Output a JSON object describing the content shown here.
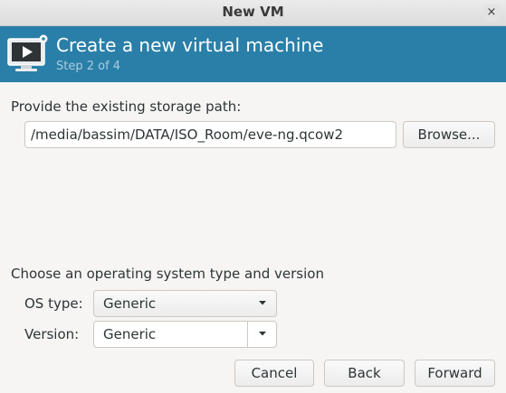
{
  "window": {
    "title": "New VM",
    "close_glyph": "×"
  },
  "banner": {
    "heading": "Create a new virtual machine",
    "step": "Step 2 of 4",
    "icon": "virtual-machine-icon",
    "background": "#2a7fa8"
  },
  "storage": {
    "prompt": "Provide the existing storage path:",
    "path_value": "/media/bassim/DATA/ISO_Room/eve-ng.qcow2",
    "browse_label": "Browse..."
  },
  "os": {
    "prompt": "Choose an operating system type and version",
    "type_label": "OS type:",
    "type_value": "Generic",
    "version_label": "Version:",
    "version_value": "Generic"
  },
  "buttons": {
    "cancel": "Cancel",
    "back": "Back",
    "forward": "Forward"
  }
}
